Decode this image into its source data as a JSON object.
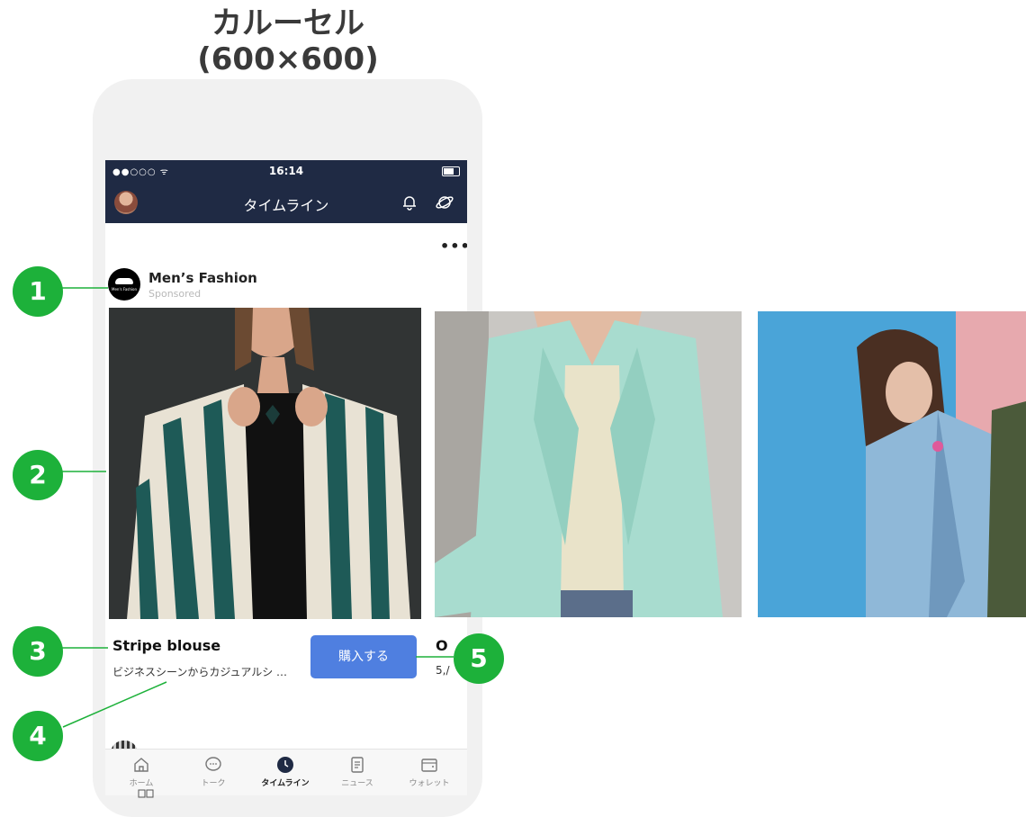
{
  "heading": {
    "line1": "カルーセル",
    "line2": "(600×600)"
  },
  "statusbar": {
    "signal": "●●○○○ ᯤ",
    "time": "16:14"
  },
  "navbar": {
    "title": "タイムライン"
  },
  "post": {
    "more": "•••",
    "brand_name": "Men’s Fashion",
    "brand_logo_text": "Men's Fashion",
    "sponsored": "Sponsored",
    "card": {
      "title": "Stripe blouse",
      "description": "ビジネスシーンからカジュアルシ …",
      "cta": "購入する"
    },
    "next_card": {
      "title": "O",
      "description": "5,/"
    }
  },
  "tabbar": {
    "items": [
      {
        "label": "ホーム",
        "icon": "home-icon",
        "active": false
      },
      {
        "label": "トーク",
        "icon": "chat-bubble-icon",
        "active": false
      },
      {
        "label": "タイムライン",
        "icon": "clock-icon",
        "active": true
      },
      {
        "label": "ニュース",
        "icon": "news-icon",
        "active": false
      },
      {
        "label": "ウォレット",
        "icon": "wallet-icon",
        "active": false
      }
    ]
  },
  "markers": [
    "1",
    "2",
    "3",
    "4",
    "5"
  ],
  "colors": {
    "navbar": "#1f2a44",
    "marker": "#1db13a",
    "cta": "#4f7fe0",
    "phone_frame": "#f1f1f1"
  }
}
